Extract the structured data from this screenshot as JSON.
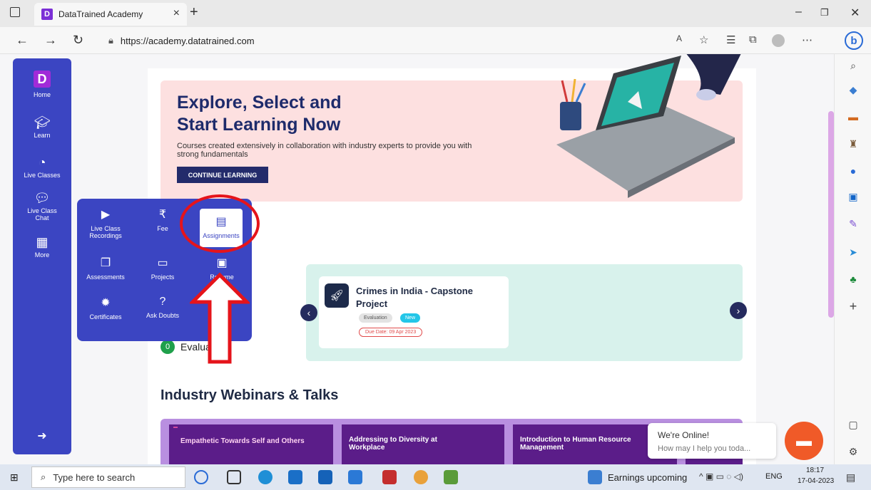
{
  "browser": {
    "tab_title": "DataTrained Academy",
    "favicon_letter": "D",
    "url": "https://academy.datatrained.com"
  },
  "app_sidebar": {
    "logo_letter": "D",
    "items": [
      {
        "label": "Home",
        "icon": "home-icon"
      },
      {
        "label": "Learn",
        "icon": "graduation-cap-icon"
      },
      {
        "label": "Live Classes",
        "icon": "broadcast-icon"
      },
      {
        "label": "Live Class Chat",
        "icon": "chat-bubbles-icon"
      },
      {
        "label": "More",
        "icon": "grid-icon"
      }
    ]
  },
  "more_menu": {
    "items": [
      {
        "label": "Live Class Recordings",
        "icon": "play-circle-icon"
      },
      {
        "label": "Fee",
        "icon": "rupee-icon"
      },
      {
        "label": "Assignments",
        "icon": "document-icon",
        "selected": true
      },
      {
        "label": "Assessments",
        "icon": "files-icon"
      },
      {
        "label": "Projects",
        "icon": "laptop-icon"
      },
      {
        "label": "Resume",
        "icon": "id-card-icon"
      },
      {
        "label": "Certificates",
        "icon": "badge-icon"
      },
      {
        "label": "Ask Doubts",
        "icon": "question-icon"
      }
    ]
  },
  "hero": {
    "title_line1": "Explore, Select and",
    "title_line2": "Start Learning Now",
    "subtitle": "Courses created extensively in collaboration with industry experts to provide you with strong fundamentals",
    "cta": "CONTINUE LEARNING"
  },
  "assignment": {
    "title": "Crimes in India - Capstone Project",
    "tag": "Evaluation",
    "badge": "New",
    "due": "Due Date: 09 Apr 2023",
    "evaluated_count": "0",
    "evaluated_label": "Evaluated"
  },
  "webinars": {
    "heading": "Industry Webinars & Talks",
    "cards": [
      {
        "title": "Empathetic Towards Self and Others"
      },
      {
        "title": "Addressing to Diversity at Workplace"
      },
      {
        "title": "Introduction to Human Resource Management"
      }
    ]
  },
  "chat": {
    "status": "We're Online!",
    "prompt": "How may I help you toda..."
  },
  "taskbar": {
    "search_placeholder": "Type here to search",
    "news": "Earnings upcoming",
    "lang": "ENG",
    "time": "18:17",
    "date": "17-04-2023"
  },
  "colors": {
    "sidebar": "#3b45c2",
    "hero_bg": "#fde0e0",
    "panel_bg": "#d8f2ec",
    "annotation": "#e5141b"
  }
}
